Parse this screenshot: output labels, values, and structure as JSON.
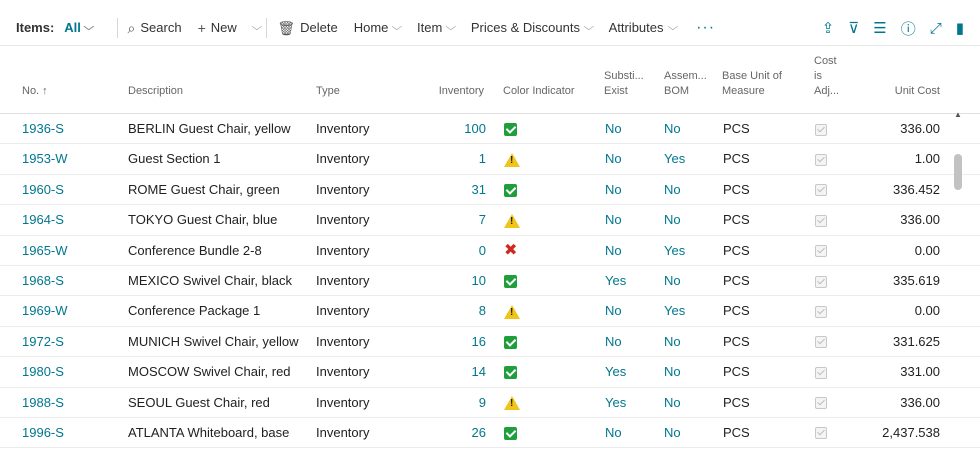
{
  "toolbar": {
    "label": "Items:",
    "filter": "All",
    "search": "Search",
    "new": "New",
    "delete": "Delete",
    "home": "Home",
    "item": "Item",
    "prices": "Prices & Discounts",
    "attributes": "Attributes",
    "more": "···"
  },
  "columns": {
    "no": "No. ↑",
    "description": "Description",
    "type": "Type",
    "inventory": "Inventory",
    "color": "Color Indicator",
    "subst_1": "Substi...",
    "subst_2": "Exist",
    "assem_1": "Assem...",
    "assem_2": "BOM",
    "base_1": "Base Unit of",
    "base_2": "Measure",
    "cost_1": "Cost",
    "cost_2": "is",
    "cost_3": "Adj...",
    "unit_cost": "Unit Cost"
  },
  "rows": [
    {
      "no": "1936-S",
      "description": "BERLIN Guest Chair, yellow",
      "type": "Inventory",
      "inventory": "100",
      "indicator": "ok",
      "subst": "No",
      "assem": "No",
      "uom": "PCS",
      "unit_cost": "336.00"
    },
    {
      "no": "1953-W",
      "description": "Guest Section 1",
      "type": "Inventory",
      "inventory": "1",
      "indicator": "warning",
      "subst": "No",
      "assem": "Yes",
      "uom": "PCS",
      "unit_cost": "1.00"
    },
    {
      "no": "1960-S",
      "description": "ROME Guest Chair, green",
      "type": "Inventory",
      "inventory": "31",
      "indicator": "ok",
      "subst": "No",
      "assem": "No",
      "uom": "PCS",
      "unit_cost": "336.452"
    },
    {
      "no": "1964-S",
      "description": "TOKYO Guest Chair, blue",
      "type": "Inventory",
      "inventory": "7",
      "indicator": "warning",
      "subst": "No",
      "assem": "No",
      "uom": "PCS",
      "unit_cost": "336.00"
    },
    {
      "no": "1965-W",
      "description": "Conference Bundle 2-8",
      "type": "Inventory",
      "inventory": "0",
      "indicator": "error",
      "subst": "No",
      "assem": "Yes",
      "uom": "PCS",
      "unit_cost": "0.00"
    },
    {
      "no": "1968-S",
      "description": "MEXICO Swivel Chair, black",
      "type": "Inventory",
      "inventory": "10",
      "indicator": "ok",
      "subst": "Yes",
      "assem": "No",
      "uom": "PCS",
      "unit_cost": "335.619"
    },
    {
      "no": "1969-W",
      "description": "Conference Package 1",
      "type": "Inventory",
      "inventory": "8",
      "indicator": "warning",
      "subst": "No",
      "assem": "Yes",
      "uom": "PCS",
      "unit_cost": "0.00"
    },
    {
      "no": "1972-S",
      "description": "MUNICH Swivel Chair, yellow",
      "type": "Inventory",
      "inventory": "16",
      "indicator": "ok",
      "subst": "No",
      "assem": "No",
      "uom": "PCS",
      "unit_cost": "331.625"
    },
    {
      "no": "1980-S",
      "description": "MOSCOW Swivel Chair, red",
      "type": "Inventory",
      "inventory": "14",
      "indicator": "ok",
      "subst": "Yes",
      "assem": "No",
      "uom": "PCS",
      "unit_cost": "331.00"
    },
    {
      "no": "1988-S",
      "description": "SEOUL Guest Chair, red",
      "type": "Inventory",
      "inventory": "9",
      "indicator": "warning",
      "subst": "Yes",
      "assem": "No",
      "uom": "PCS",
      "unit_cost": "336.00"
    },
    {
      "no": "1996-S",
      "description": "ATLANTA Whiteboard, base",
      "type": "Inventory",
      "inventory": "26",
      "indicator": "ok",
      "subst": "No",
      "assem": "No",
      "uom": "PCS",
      "unit_cost": "2,437.538"
    }
  ],
  "colors": {
    "link": "#00778f",
    "ok": "#1e9f3c",
    "warning": "#f0c419",
    "error": "#d0281e"
  }
}
